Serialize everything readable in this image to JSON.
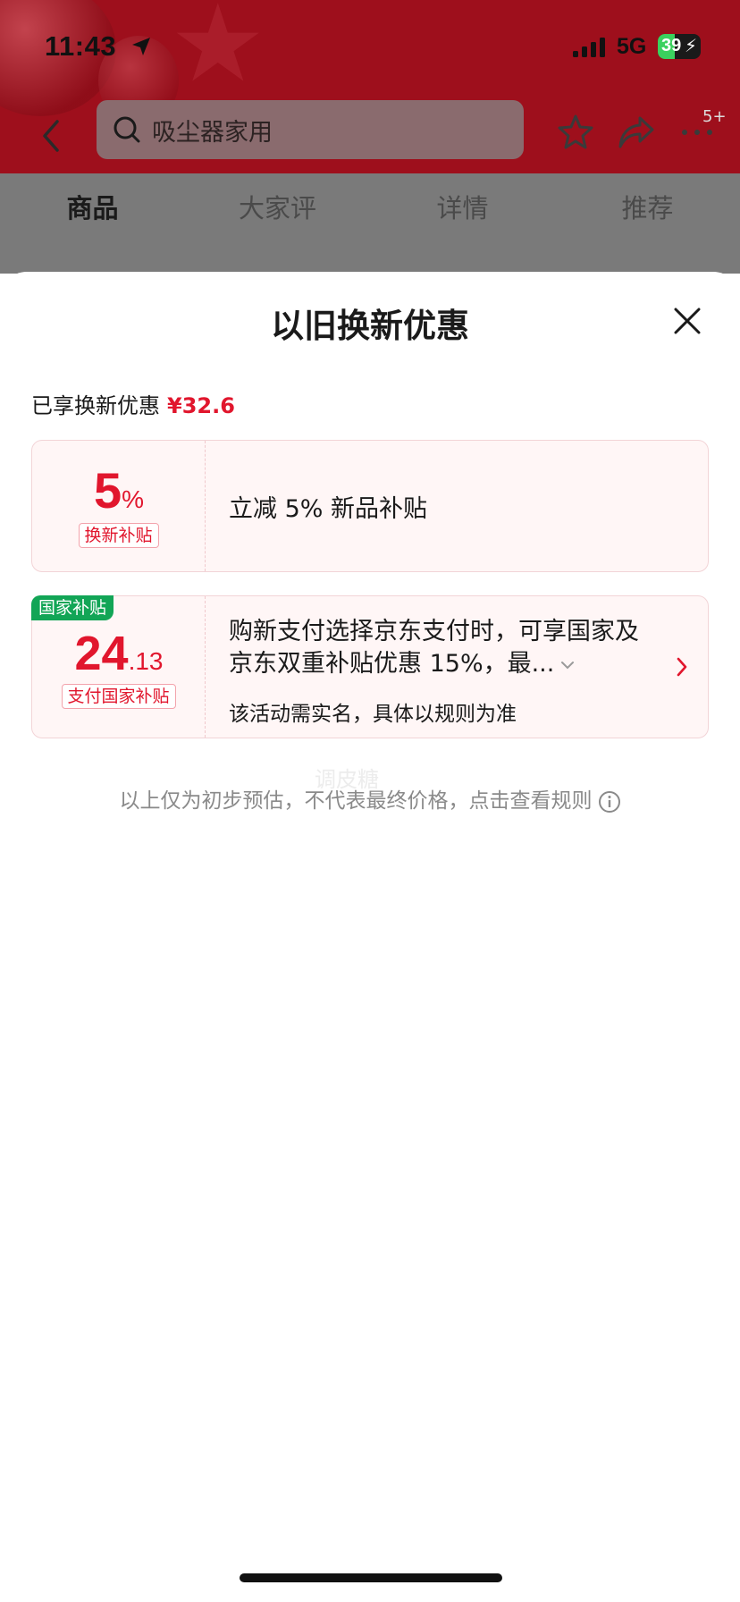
{
  "status_bar": {
    "time": "11:43",
    "network": "5G",
    "battery": "39",
    "battery_level": 0.39
  },
  "navbar": {
    "search_text": "吸尘器家用",
    "more_badge": "5+"
  },
  "tabs": [
    {
      "label": "商品",
      "active": true
    },
    {
      "label": "大家评",
      "active": false
    },
    {
      "label": "详情",
      "active": false
    },
    {
      "label": "推荐",
      "active": false
    }
  ],
  "sheet": {
    "title": "以旧换新优惠",
    "summary_label": "已享换新优惠",
    "summary_amount": "¥32.6",
    "offers": [
      {
        "value_main": "5",
        "value_unit": "%",
        "tag": "换新补贴",
        "description": "立减 5% 新品补贴"
      },
      {
        "badge": "国家补贴",
        "value_main": "24",
        "value_decimal": ".13",
        "tag": "支付国家补贴",
        "description": "购新支付选择京东支付时，可享国家及京东双重补贴优惠 15%，最...",
        "note": "该活动需实名，具体以规则为准"
      }
    ],
    "watermark": "调皮糖",
    "footer": "以上仅为初步预估，不代表最终价格，点击查看规则"
  },
  "colors": {
    "accent": "#e1162d",
    "gov_green": "#12a556"
  }
}
